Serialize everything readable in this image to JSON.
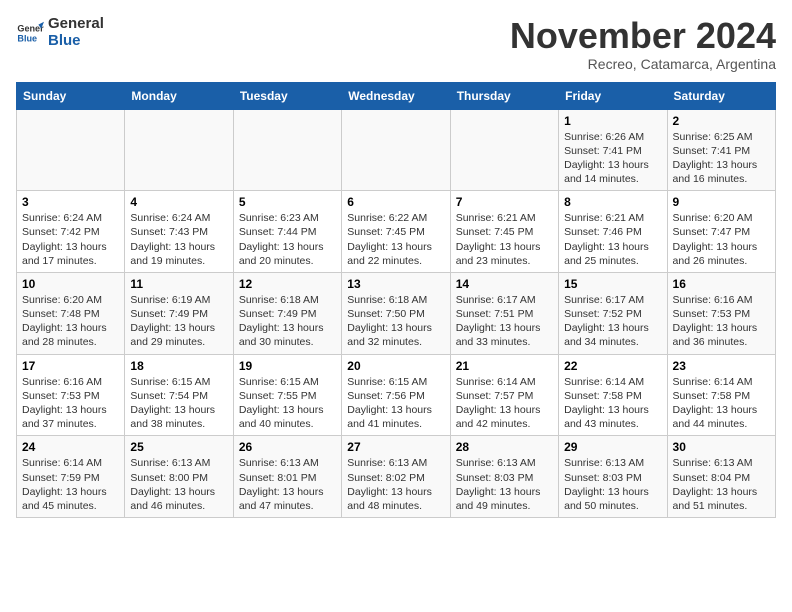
{
  "logo": {
    "line1": "General",
    "line2": "Blue"
  },
  "title": "November 2024",
  "subtitle": "Recreo, Catamarca, Argentina",
  "weekdays": [
    "Sunday",
    "Monday",
    "Tuesday",
    "Wednesday",
    "Thursday",
    "Friday",
    "Saturday"
  ],
  "weeks": [
    [
      {
        "day": "",
        "info": ""
      },
      {
        "day": "",
        "info": ""
      },
      {
        "day": "",
        "info": ""
      },
      {
        "day": "",
        "info": ""
      },
      {
        "day": "",
        "info": ""
      },
      {
        "day": "1",
        "info": "Sunrise: 6:26 AM\nSunset: 7:41 PM\nDaylight: 13 hours and 14 minutes."
      },
      {
        "day": "2",
        "info": "Sunrise: 6:25 AM\nSunset: 7:41 PM\nDaylight: 13 hours and 16 minutes."
      }
    ],
    [
      {
        "day": "3",
        "info": "Sunrise: 6:24 AM\nSunset: 7:42 PM\nDaylight: 13 hours and 17 minutes."
      },
      {
        "day": "4",
        "info": "Sunrise: 6:24 AM\nSunset: 7:43 PM\nDaylight: 13 hours and 19 minutes."
      },
      {
        "day": "5",
        "info": "Sunrise: 6:23 AM\nSunset: 7:44 PM\nDaylight: 13 hours and 20 minutes."
      },
      {
        "day": "6",
        "info": "Sunrise: 6:22 AM\nSunset: 7:45 PM\nDaylight: 13 hours and 22 minutes."
      },
      {
        "day": "7",
        "info": "Sunrise: 6:21 AM\nSunset: 7:45 PM\nDaylight: 13 hours and 23 minutes."
      },
      {
        "day": "8",
        "info": "Sunrise: 6:21 AM\nSunset: 7:46 PM\nDaylight: 13 hours and 25 minutes."
      },
      {
        "day": "9",
        "info": "Sunrise: 6:20 AM\nSunset: 7:47 PM\nDaylight: 13 hours and 26 minutes."
      }
    ],
    [
      {
        "day": "10",
        "info": "Sunrise: 6:20 AM\nSunset: 7:48 PM\nDaylight: 13 hours and 28 minutes."
      },
      {
        "day": "11",
        "info": "Sunrise: 6:19 AM\nSunset: 7:49 PM\nDaylight: 13 hours and 29 minutes."
      },
      {
        "day": "12",
        "info": "Sunrise: 6:18 AM\nSunset: 7:49 PM\nDaylight: 13 hours and 30 minutes."
      },
      {
        "day": "13",
        "info": "Sunrise: 6:18 AM\nSunset: 7:50 PM\nDaylight: 13 hours and 32 minutes."
      },
      {
        "day": "14",
        "info": "Sunrise: 6:17 AM\nSunset: 7:51 PM\nDaylight: 13 hours and 33 minutes."
      },
      {
        "day": "15",
        "info": "Sunrise: 6:17 AM\nSunset: 7:52 PM\nDaylight: 13 hours and 34 minutes."
      },
      {
        "day": "16",
        "info": "Sunrise: 6:16 AM\nSunset: 7:53 PM\nDaylight: 13 hours and 36 minutes."
      }
    ],
    [
      {
        "day": "17",
        "info": "Sunrise: 6:16 AM\nSunset: 7:53 PM\nDaylight: 13 hours and 37 minutes."
      },
      {
        "day": "18",
        "info": "Sunrise: 6:15 AM\nSunset: 7:54 PM\nDaylight: 13 hours and 38 minutes."
      },
      {
        "day": "19",
        "info": "Sunrise: 6:15 AM\nSunset: 7:55 PM\nDaylight: 13 hours and 40 minutes."
      },
      {
        "day": "20",
        "info": "Sunrise: 6:15 AM\nSunset: 7:56 PM\nDaylight: 13 hours and 41 minutes."
      },
      {
        "day": "21",
        "info": "Sunrise: 6:14 AM\nSunset: 7:57 PM\nDaylight: 13 hours and 42 minutes."
      },
      {
        "day": "22",
        "info": "Sunrise: 6:14 AM\nSunset: 7:58 PM\nDaylight: 13 hours and 43 minutes."
      },
      {
        "day": "23",
        "info": "Sunrise: 6:14 AM\nSunset: 7:58 PM\nDaylight: 13 hours and 44 minutes."
      }
    ],
    [
      {
        "day": "24",
        "info": "Sunrise: 6:14 AM\nSunset: 7:59 PM\nDaylight: 13 hours and 45 minutes."
      },
      {
        "day": "25",
        "info": "Sunrise: 6:13 AM\nSunset: 8:00 PM\nDaylight: 13 hours and 46 minutes."
      },
      {
        "day": "26",
        "info": "Sunrise: 6:13 AM\nSunset: 8:01 PM\nDaylight: 13 hours and 47 minutes."
      },
      {
        "day": "27",
        "info": "Sunrise: 6:13 AM\nSunset: 8:02 PM\nDaylight: 13 hours and 48 minutes."
      },
      {
        "day": "28",
        "info": "Sunrise: 6:13 AM\nSunset: 8:03 PM\nDaylight: 13 hours and 49 minutes."
      },
      {
        "day": "29",
        "info": "Sunrise: 6:13 AM\nSunset: 8:03 PM\nDaylight: 13 hours and 50 minutes."
      },
      {
        "day": "30",
        "info": "Sunrise: 6:13 AM\nSunset: 8:04 PM\nDaylight: 13 hours and 51 minutes."
      }
    ]
  ]
}
